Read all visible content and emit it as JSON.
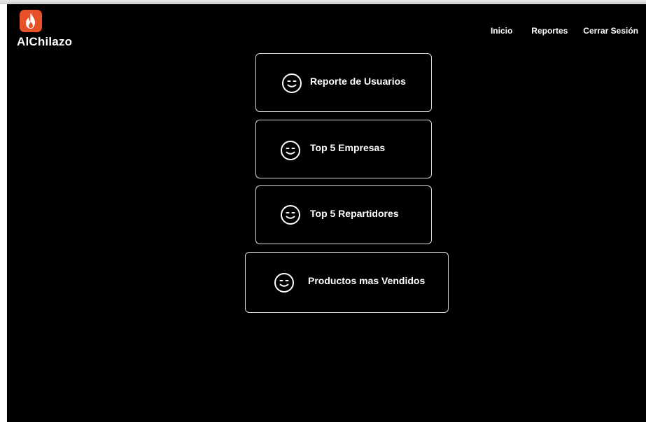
{
  "brand": {
    "name": "AlChilazo",
    "logo_icon": "flame-icon",
    "logo_color": "#e8502a"
  },
  "nav": {
    "inicio": "Inicio",
    "reportes": "Reportes",
    "cerrar_sesion": "Cerrar Sesión"
  },
  "reports": [
    {
      "label": "Reporte de Usuarios",
      "icon": "smile-icon"
    },
    {
      "label": "Top 5 Empresas",
      "icon": "smile-icon"
    },
    {
      "label": "Top 5 Repartidores",
      "icon": "smile-icon"
    },
    {
      "label": "Productos mas Vendidos",
      "icon": "smile-icon"
    }
  ]
}
